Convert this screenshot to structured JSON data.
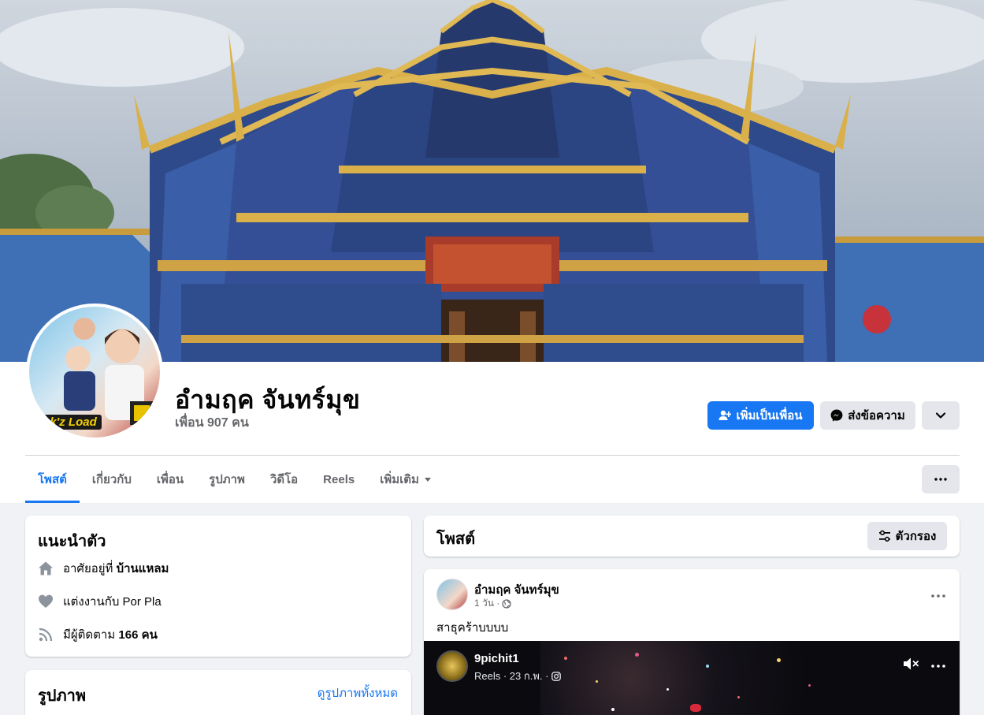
{
  "profile": {
    "name": "อำมฤค จันทร์มุข",
    "friends_count": "เพื่อน 907 คน",
    "avatar_tag": "ck'z Load"
  },
  "actions": {
    "add_friend": "เพิ่มเป็นเพื่อน",
    "message": "ส่งข้อความ"
  },
  "tabs": [
    {
      "label": "โพสต์",
      "active": true
    },
    {
      "label": "เกี่ยวกับ"
    },
    {
      "label": "เพื่อน"
    },
    {
      "label": "รูปภาพ"
    },
    {
      "label": "วิดีโอ"
    },
    {
      "label": "Reels"
    },
    {
      "label": "เพิ่มเติม"
    }
  ],
  "intro": {
    "title": "แนะนำตัว",
    "lives_prefix": "อาศัยอยู่ที่ ",
    "lives_place": "บ้านแหลม",
    "married_prefix": "แต่งงานกับ ",
    "married_to": "Por Pla",
    "followers_prefix": "มีผู้ติดตาม ",
    "followers_count": "166 คน"
  },
  "photos": {
    "title": "รูปภาพ",
    "see_all": "ดูรูปภาพทั้งหมด"
  },
  "posts_section": {
    "title": "โพสต์",
    "filter_label": "ตัวกรอง"
  },
  "post": {
    "author": "อำมฤค จันทร์มุข",
    "time": "1 วัน ·",
    "text": "สาธุคร้าบบบบ",
    "reel": {
      "author": "9pichit1",
      "meta": "Reels · 23 ก.พ. ·"
    }
  },
  "colors": {
    "accent": "#1877f2",
    "background": "#f0f2f5",
    "secondary_button": "#e4e6eb"
  }
}
